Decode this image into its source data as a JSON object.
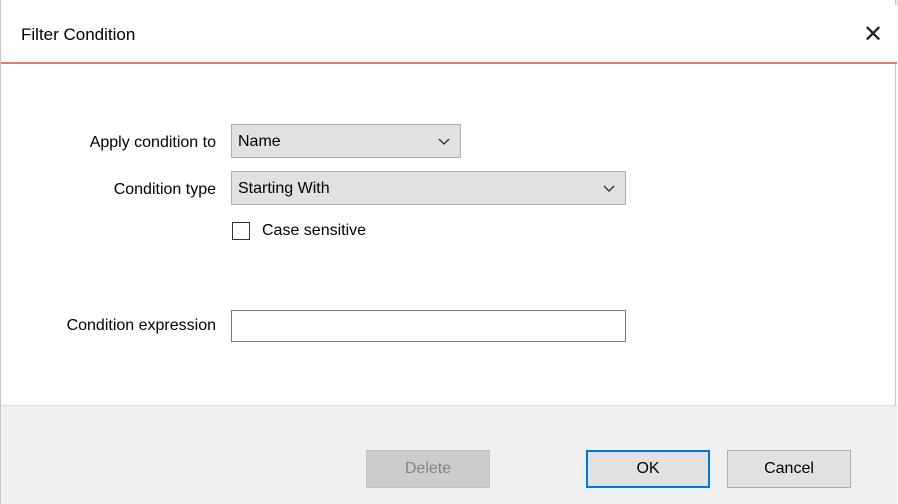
{
  "dialog": {
    "title": "Filter Condition",
    "close_symbol": "✕"
  },
  "form": {
    "apply_condition_label": "Apply condition to",
    "apply_condition_value": "Name",
    "condition_type_label": "Condition type",
    "condition_type_value": "Starting With",
    "case_sensitive_label": "Case sensitive",
    "case_sensitive_checked": false,
    "condition_expression_label": "Condition expression",
    "condition_expression_value": ""
  },
  "buttons": {
    "delete_label": "Delete",
    "ok_label": "OK",
    "cancel_label": "Cancel"
  },
  "colors": {
    "accent_line": "#e27c7c",
    "default_button_border": "#0078d7",
    "footer_background": "#f0f0f0"
  },
  "icons": {
    "close": "close-icon",
    "dropdown": "chevron-down-icon"
  }
}
